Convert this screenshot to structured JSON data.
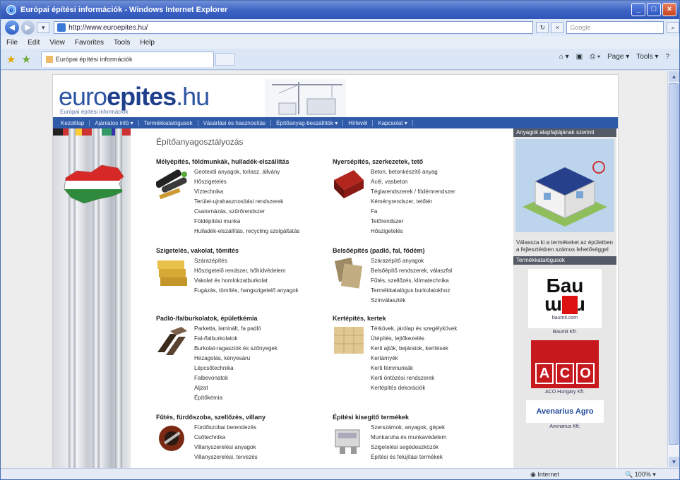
{
  "window": {
    "title": "Európai építési információk - Windows Internet Explorer",
    "controls": {
      "minimize": "_",
      "maximize": "□",
      "close": "×"
    }
  },
  "browser": {
    "address": "http://www.euroepites.hu/",
    "search_placeholder": "Google",
    "menu": [
      "File",
      "Edit",
      "View",
      "Favorites",
      "Tools",
      "Help"
    ],
    "tab_title": "Európai építési információk",
    "commands": [
      "Page ▾",
      "Tools ▾"
    ],
    "status_zone": "Internet",
    "zoom": "100%"
  },
  "site": {
    "logo_prefix": "euro",
    "logo_bold": "epites",
    "logo_suffix": ".hu",
    "tagline": "Európai építési információk",
    "nav": [
      "Kezdőlap",
      "Ajánlatos infó ▾",
      "Termékkatalógusok",
      "Vásárlási és hasznosítás",
      "Építőanyag-beszállítók ▾",
      "Hírlevél",
      "Kapcsolat ▾"
    ]
  },
  "main": {
    "heading": "Építőanyagosztályozás",
    "categories": [
      {
        "title": "Mélyépítés, földmunkák, hulladék-elszállítás",
        "items": [
          "Geotextil anyagok, torlasz, állvány",
          "Hőszigetelés",
          "Víztechnika",
          "Terület-ujrahasznosítási rendszerek",
          "Csatornázás, szűrőrendszer",
          "Földépítési munka",
          "Hulladék-elszállítás, recycling szolgáltatás"
        ]
      },
      {
        "title": "Nyersépítés, szerkezetek, tető",
        "items": [
          "Beton, betonkészítő anyag",
          "Acél, vasbeton",
          "Téglarendszerek / födémrendszer",
          "Kéményrendszer, tetőtér",
          "Fa",
          "Tetőrendszer",
          "Hőszigetelés"
        ]
      },
      {
        "title": "Szigetelés, vakolat, tömítés",
        "items": [
          "Szárazépítés",
          "Hőszigetelő rendszer, hőhídvédelem",
          "Vakolat és homlokzatburkolat",
          "Fugázás, tömítés, hangszigetelő anyagok"
        ]
      },
      {
        "title": "Belsőépítés (padló, fal, födém)",
        "items": [
          "Szárazépítő anyagok",
          "Belsőépítő rendszerek, válaszfal",
          "Fűtés, szellőzés, klímatechnika",
          "Termékkatalógus burkolatokhoz",
          "Színválaszték"
        ]
      },
      {
        "title": "Padló-/falburkolatok, épületkémia",
        "items": [
          "Parketta, laminált, fa padló",
          "Fal-/falburkolatok",
          "Burkolat-ragasztók és szőnyegek",
          "Hézagolás, kényesáru",
          "Lépcsőtechnika",
          "Falbevonatok",
          "Aljzat",
          "Építőkémia"
        ]
      },
      {
        "title": "Kertépítés, kertek",
        "items": [
          "Térkövek, járólap és szegélykövek",
          "Útépítés, lejtőkezelés",
          "Kerti ajtók, bejáratok, kerítések",
          "Kertárnyék",
          "Kerti fémmunkák",
          "Kerti öntözési rendszerek",
          "Kertépítés dekorációk"
        ]
      },
      {
        "title": "Fűtés, fürdőszoba, szellőzés, villany",
        "items": [
          "Fürdőszobai berendezés",
          "Csőtechnika",
          "Villanyszerelési anyagok",
          "Villanyszerelési, tervezés"
        ]
      },
      {
        "title": "Építési kisegítő termékek",
        "items": [
          "Szerszámok, anyagok, gépek",
          "Munkaruha és munkavédelem",
          "Szigetelési segédeszközök",
          "Építési és felújítási termékek"
        ]
      }
    ]
  },
  "sidebar": {
    "section1": "Anyagok alapfajtájának szerinti",
    "promo_text": "Válassza ki a termékeket az épületben a fejlesztésben számos lehetőséggel",
    "section2": "Termékkatalógusok",
    "brands": [
      {
        "name": "baumit.com",
        "link": "Baumit Kft."
      },
      {
        "name": "ACO",
        "link": "ACO Hungary Kft."
      },
      {
        "name": "Avenarius Agro",
        "link": "Avenarius Kft."
      }
    ]
  },
  "colors": {
    "accent": "#2c55a2",
    "nav": "#2f5aa8",
    "sidebar_header": "#555b66",
    "aco_red": "#c7181e"
  }
}
